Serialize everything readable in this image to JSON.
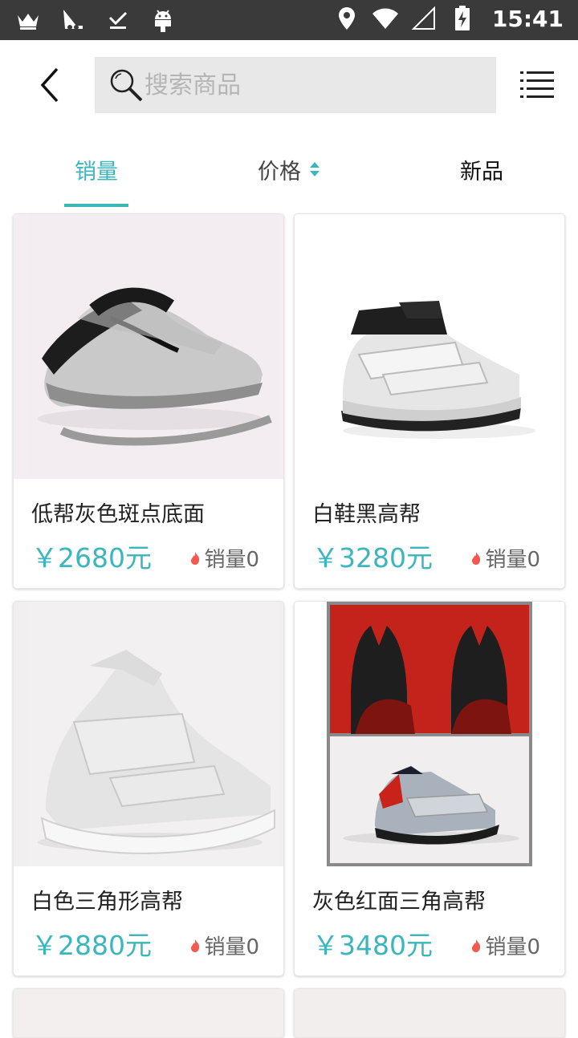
{
  "status_bar": {
    "time": "15:41"
  },
  "search": {
    "placeholder": "搜索商品"
  },
  "tabs": [
    {
      "label": "销量",
      "active": true
    },
    {
      "label": "价格",
      "active": false
    },
    {
      "label": "新品",
      "active": false
    }
  ],
  "products": [
    {
      "name": "低帮灰色斑点底面",
      "price": "￥2680元",
      "sales": "销量0"
    },
    {
      "name": "白鞋黑高帮",
      "price": "￥3280元",
      "sales": "销量0"
    },
    {
      "name": "白色三角形高帮",
      "price": "￥2880元",
      "sales": "销量0"
    },
    {
      "name": "灰色红面三角高帮",
      "price": "￥3480元",
      "sales": "销量0"
    }
  ],
  "colors": {
    "accent": "#3bb6bd",
    "status_bar": "#3a3a3a",
    "search_bg": "#e8e8e8"
  }
}
